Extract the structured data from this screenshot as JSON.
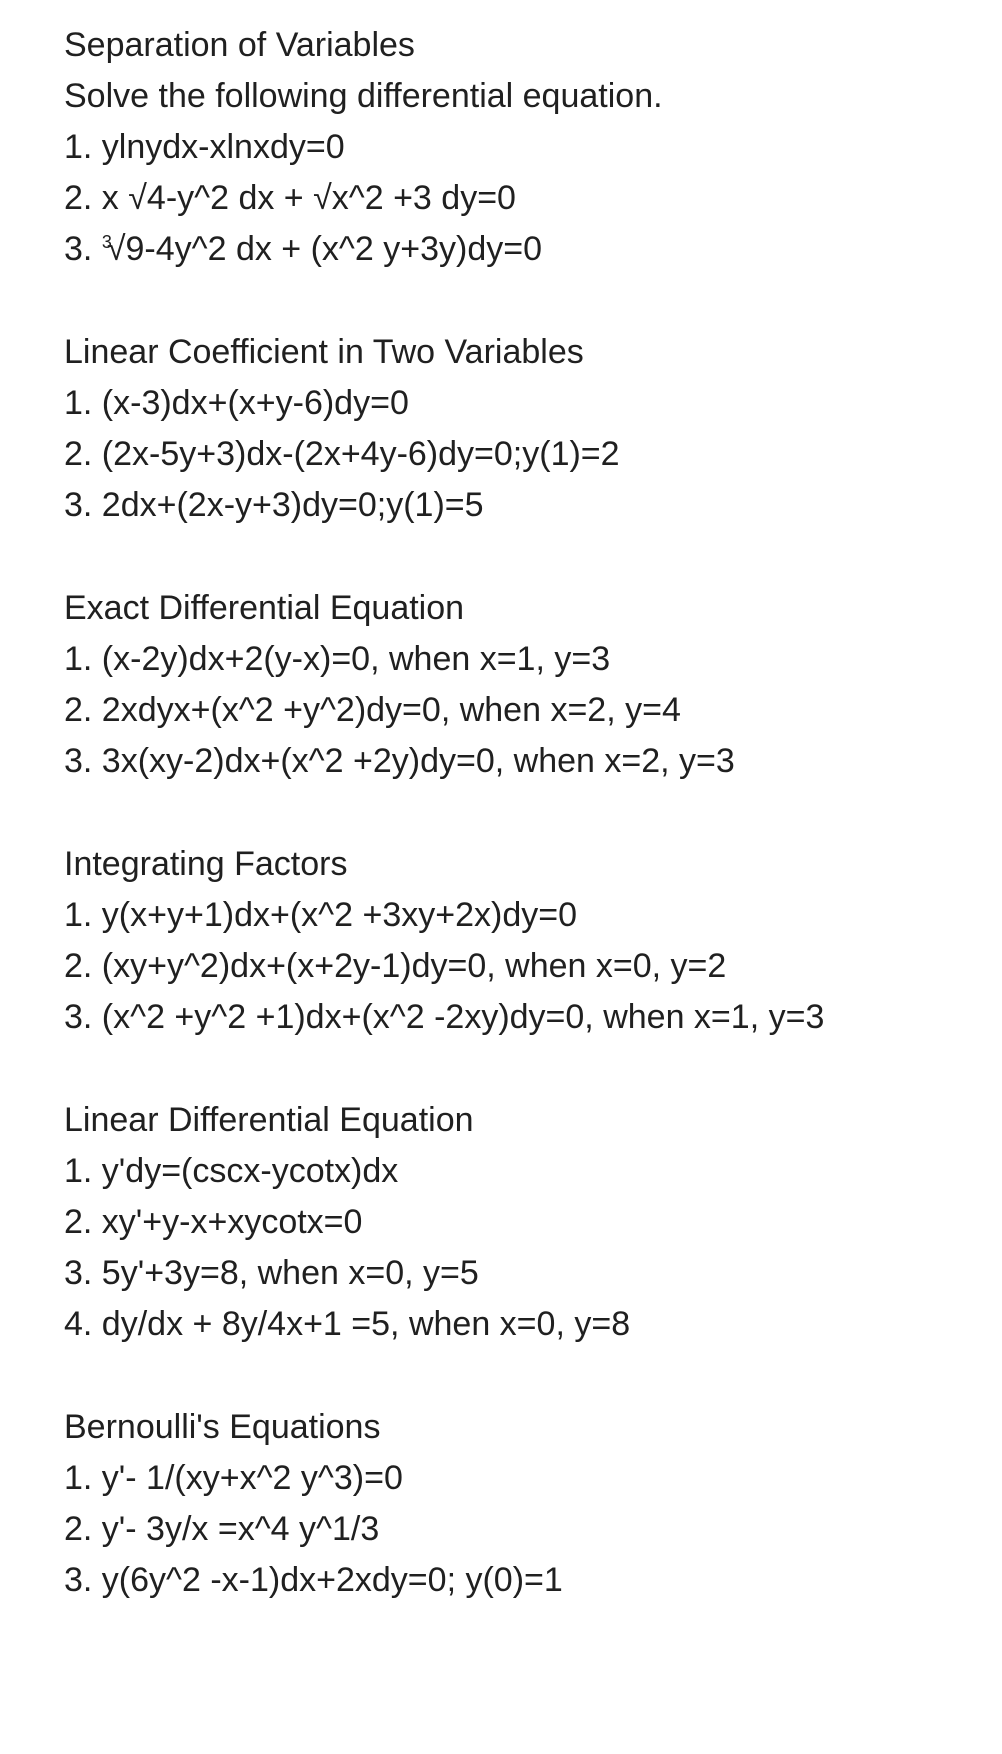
{
  "sections": [
    {
      "title": "Separation of Variables",
      "intro": "Solve the following differential equation.",
      "problems": [
        "1. ylnydx-xlnxdy=0",
        "2. x √4-y^2 dx + √x^2 +3 dy=0",
        "3. ∛9-4y^2 dx + (x^2 y+3y)dy=0"
      ]
    },
    {
      "title": "Linear Coefficient in Two Variables",
      "intro": null,
      "problems": [
        "1. (x-3)dx+(x+y-6)dy=0",
        "2. (2x-5y+3)dx-(2x+4y-6)dy=0;y(1)=2",
        "3. 2dx+(2x-y+3)dy=0;y(1)=5"
      ]
    },
    {
      "title": "Exact Differential Equation",
      "intro": null,
      "problems": [
        "1. (x-2y)dx+2(y-x)=0, when x=1, y=3",
        "2. 2xdyx+(x^2 +y^2)dy=0, when x=2, y=4",
        "3. 3x(xy-2)dx+(x^2 +2y)dy=0, when x=2, y=3"
      ]
    },
    {
      "title": "Integrating Factors",
      "intro": null,
      "problems": [
        "1. y(x+y+1)dx+(x^2 +3xy+2x)dy=0",
        "2. (xy+y^2)dx+(x+2y-1)dy=0, when x=0, y=2",
        "3. (x^2 +y^2 +1)dx+(x^2 -2xy)dy=0, when x=1, y=3"
      ]
    },
    {
      "title": "Linear Differential Equation",
      "intro": null,
      "problems": [
        "1. y'dy=(cscx-ycotx)dx",
        "2. xy'+y-x+xycotx=0",
        "3. 5y'+3y=8, when x=0, y=5",
        "4. dy/dx + 8y/4x+1 =5, when x=0, y=8"
      ]
    },
    {
      "title": "Bernoulli's Equations",
      "intro": null,
      "problems": [
        "1. y'- 1/(xy+x^2 y^3)=0",
        "2. y'- 3y/x =x^4 y^1/3",
        "3. y(6y^2 -x-1)dx+2xdy=0; y(0)=1"
      ]
    }
  ],
  "special": {
    "cube_root_exp": "3",
    "cube_root_radical": "√",
    "problem3_rest": "9-4y^2 dx + (x^2 y+3y)dy=0",
    "problem3_prefix": "3. "
  }
}
